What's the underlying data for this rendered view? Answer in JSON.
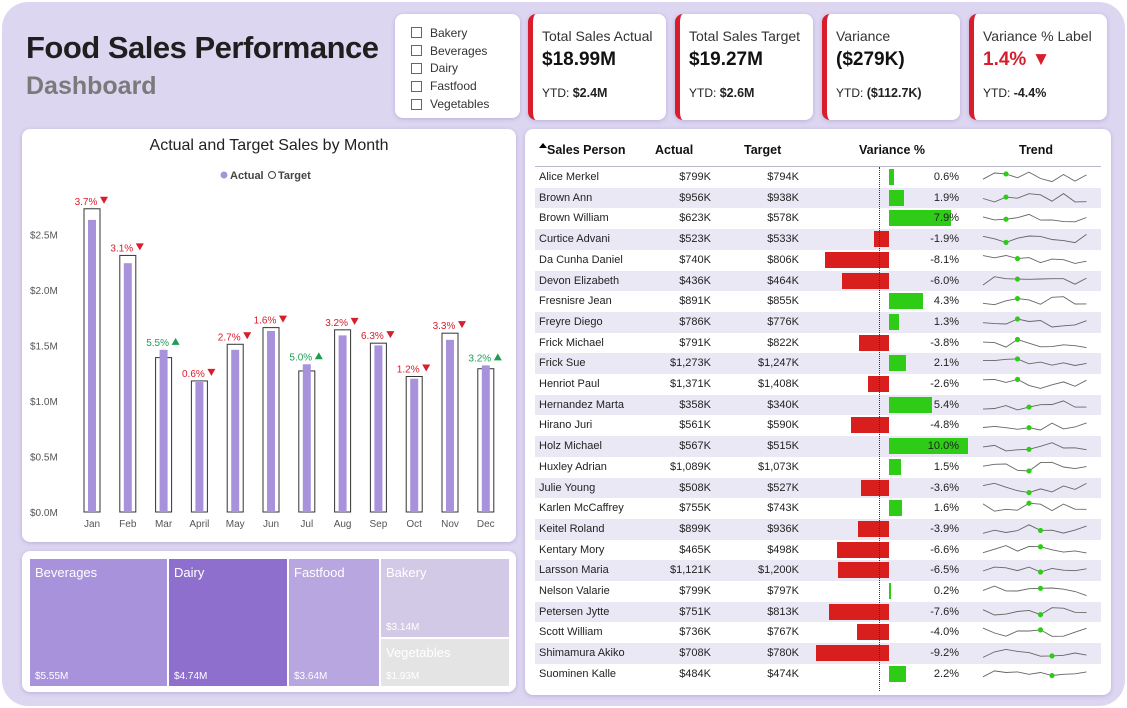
{
  "header": {
    "title": "Food Sales Performance",
    "subtitle": "Dashboard"
  },
  "slicer": {
    "items": [
      "Bakery",
      "Beverages",
      "Dairy",
      "Fastfood",
      "Vegetables"
    ]
  },
  "kpis": [
    {
      "label": "Total Sales Actual",
      "value": "$18.99M",
      "ytd_label": "YTD:",
      "ytd_value": "$2.4M"
    },
    {
      "label": "Total Sales Target",
      "value": "$19.27M",
      "ytd_label": "YTD:",
      "ytd_value": "$2.6M"
    },
    {
      "label": "Variance",
      "value": "($279K)",
      "ytd_label": "YTD:",
      "ytd_value": "($112.7K)"
    },
    {
      "label": "Variance % Label",
      "value": "1.4% ▼",
      "ytd_label": "YTD:",
      "ytd_value": "-4.4%"
    }
  ],
  "colors": {
    "accent": "#d81d2c",
    "actual": "#a892dc",
    "positive": "#2ecc17",
    "negative": "#d91e1e",
    "up": "#1e9e52"
  },
  "chart_data": {
    "type": "bar",
    "title": "Actual and Target Sales by Month",
    "legend": [
      "Actual",
      "Target"
    ],
    "legend_position": "top-center",
    "categories": [
      "Jan",
      "Feb",
      "Mar",
      "April",
      "May",
      "Jun",
      "Jul",
      "Aug",
      "Sep",
      "Oct",
      "Nov",
      "Dec"
    ],
    "series": [
      {
        "name": "Actual",
        "values": [
          2.63,
          2.24,
          1.46,
          1.17,
          1.46,
          1.63,
          1.33,
          1.59,
          1.5,
          1.2,
          1.55,
          1.32
        ]
      },
      {
        "name": "Target",
        "values": [
          2.73,
          2.31,
          1.39,
          1.18,
          1.51,
          1.66,
          1.27,
          1.64,
          1.52,
          1.22,
          1.61,
          1.29
        ]
      }
    ],
    "data_labels": [
      "3.7%",
      "3.1%",
      "5.5%",
      "0.6%",
      "2.7%",
      "1.6%",
      "5.0%",
      "3.2%",
      "6.3%",
      "1.2%",
      "3.3%",
      "3.2%"
    ],
    "label_direction": [
      "down",
      "down",
      "up",
      "down",
      "down",
      "down",
      "up",
      "down",
      "down",
      "down",
      "down",
      "up"
    ],
    "ytick_labels": [
      "$0.0M",
      "$0.5M",
      "$1.0M",
      "$1.5M",
      "$2.0M",
      "$2.5M"
    ],
    "ylim": [
      0,
      2.8
    ]
  },
  "treemap": [
    {
      "name": "Beverages",
      "value": "$5.55M",
      "color": "#a892dc"
    },
    {
      "name": "Dairy",
      "value": "$4.74M",
      "color": "#8e6fcd"
    },
    {
      "name": "Fastfood",
      "value": "$3.64M",
      "color": "#b7a6df"
    },
    {
      "name": "Bakery",
      "value": "$3.14M",
      "color": "#d2c9e6"
    },
    {
      "name": "Vegetables",
      "value": "$1.93M",
      "color": "#e4e4e4"
    }
  ],
  "table": {
    "headers": [
      "Sales Person",
      "Actual",
      "Target",
      "Variance %",
      "Trend"
    ],
    "rows": [
      {
        "name": "Alice Merkel",
        "actual": "$799K",
        "target": "$794K",
        "pct": "0.6%",
        "value": 0.6
      },
      {
        "name": "Brown Ann",
        "actual": "$956K",
        "target": "$938K",
        "pct": "1.9%",
        "value": 1.9
      },
      {
        "name": "Brown William",
        "actual": "$623K",
        "target": "$578K",
        "pct": "7.9%",
        "value": 7.9
      },
      {
        "name": "Curtice Advani",
        "actual": "$523K",
        "target": "$533K",
        "pct": "-1.9%",
        "value": -1.9
      },
      {
        "name": "Da Cunha Daniel",
        "actual": "$740K",
        "target": "$806K",
        "pct": "-8.1%",
        "value": -8.1
      },
      {
        "name": "Devon Elizabeth",
        "actual": "$436K",
        "target": "$464K",
        "pct": "-6.0%",
        "value": -6.0
      },
      {
        "name": "Fresnisre Jean",
        "actual": "$891K",
        "target": "$855K",
        "pct": "4.3%",
        "value": 4.3
      },
      {
        "name": "Freyre Diego",
        "actual": "$786K",
        "target": "$776K",
        "pct": "1.3%",
        "value": 1.3
      },
      {
        "name": "Frick Michael",
        "actual": "$791K",
        "target": "$822K",
        "pct": "-3.8%",
        "value": -3.8
      },
      {
        "name": "Frick Sue",
        "actual": "$1,273K",
        "target": "$1,247K",
        "pct": "2.1%",
        "value": 2.1
      },
      {
        "name": "Henriot Paul",
        "actual": "$1,371K",
        "target": "$1,408K",
        "pct": "-2.6%",
        "value": -2.6
      },
      {
        "name": "Hernandez Marta",
        "actual": "$358K",
        "target": "$340K",
        "pct": "5.4%",
        "value": 5.4
      },
      {
        "name": "Hirano Juri",
        "actual": "$561K",
        "target": "$590K",
        "pct": "-4.8%",
        "value": -4.8
      },
      {
        "name": "Holz Michael",
        "actual": "$567K",
        "target": "$515K",
        "pct": "10.0%",
        "value": 10.0
      },
      {
        "name": "Huxley Adrian",
        "actual": "$1,089K",
        "target": "$1,073K",
        "pct": "1.5%",
        "value": 1.5
      },
      {
        "name": "Julie Young",
        "actual": "$508K",
        "target": "$527K",
        "pct": "-3.6%",
        "value": -3.6
      },
      {
        "name": "Karlen McCaffrey",
        "actual": "$755K",
        "target": "$743K",
        "pct": "1.6%",
        "value": 1.6
      },
      {
        "name": "Keitel Roland",
        "actual": "$899K",
        "target": "$936K",
        "pct": "-3.9%",
        "value": -3.9
      },
      {
        "name": "Kentary Mory",
        "actual": "$465K",
        "target": "$498K",
        "pct": "-6.6%",
        "value": -6.6
      },
      {
        "name": "Larsson Maria",
        "actual": "$1,121K",
        "target": "$1,200K",
        "pct": "-6.5%",
        "value": -6.5
      },
      {
        "name": "Nelson Valarie",
        "actual": "$799K",
        "target": "$797K",
        "pct": "0.2%",
        "value": 0.2
      },
      {
        "name": "Petersen Jytte",
        "actual": "$751K",
        "target": "$813K",
        "pct": "-7.6%",
        "value": -7.6
      },
      {
        "name": "Scott William",
        "actual": "$736K",
        "target": "$767K",
        "pct": "-4.0%",
        "value": -4.0
      },
      {
        "name": "Shimamura Akiko",
        "actual": "$708K",
        "target": "$780K",
        "pct": "-9.2%",
        "value": -9.2
      },
      {
        "name": "Suominen Kalle",
        "actual": "$484K",
        "target": "$474K",
        "pct": "2.2%",
        "value": 2.2
      }
    ]
  }
}
